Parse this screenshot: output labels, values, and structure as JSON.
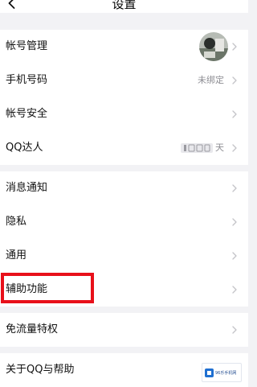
{
  "header": {
    "title": "设置"
  },
  "groups": [
    {
      "items": [
        {
          "label": "帐号管理"
        },
        {
          "label": "手机号码",
          "value": "未绑定"
        },
        {
          "label": "帐号安全"
        },
        {
          "label": "QQ达人",
          "value": "天"
        }
      ]
    },
    {
      "items": [
        {
          "label": "消息通知"
        },
        {
          "label": "隐私"
        },
        {
          "label": "通用"
        },
        {
          "label": "辅助功能"
        }
      ]
    },
    {
      "items": [
        {
          "label": "免流量特权"
        }
      ]
    },
    {
      "items": [
        {
          "label": "关于QQ与帮助"
        }
      ]
    }
  ],
  "watermark": {
    "text": "96乐手机网"
  },
  "colors": {
    "highlight": "#e8101a",
    "background": "#f2f2f5",
    "chevron": "#c4c4c8"
  }
}
